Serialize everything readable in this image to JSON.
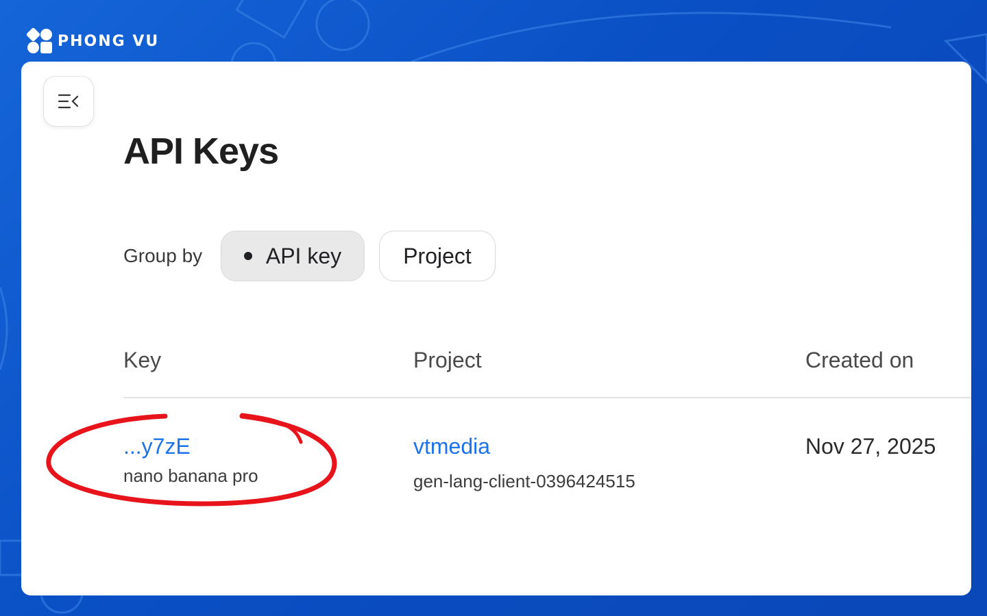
{
  "brand": {
    "name": "PHONG VU",
    "logo_icon": "phongvu-logo-icon"
  },
  "toolbar": {
    "menu_icon": "menu-collapse-icon"
  },
  "page": {
    "title": "API Keys"
  },
  "group_by": {
    "label": "Group by",
    "options": [
      {
        "label": "API key",
        "selected": true
      },
      {
        "label": "Project",
        "selected": false
      }
    ]
  },
  "table": {
    "columns": [
      "Key",
      "Project",
      "Created on"
    ],
    "rows": [
      {
        "key": "...y7zE",
        "key_name": "nano banana pro",
        "project_name": "vtmedia",
        "project_id": "gen-lang-client-0396424515",
        "created_on": "Nov 27, 2025"
      }
    ]
  },
  "colors": {
    "background": "#0a4fc4",
    "link": "#1a73e8",
    "annotation": "#e8141c",
    "selected_chip": "#e9e9e9"
  }
}
